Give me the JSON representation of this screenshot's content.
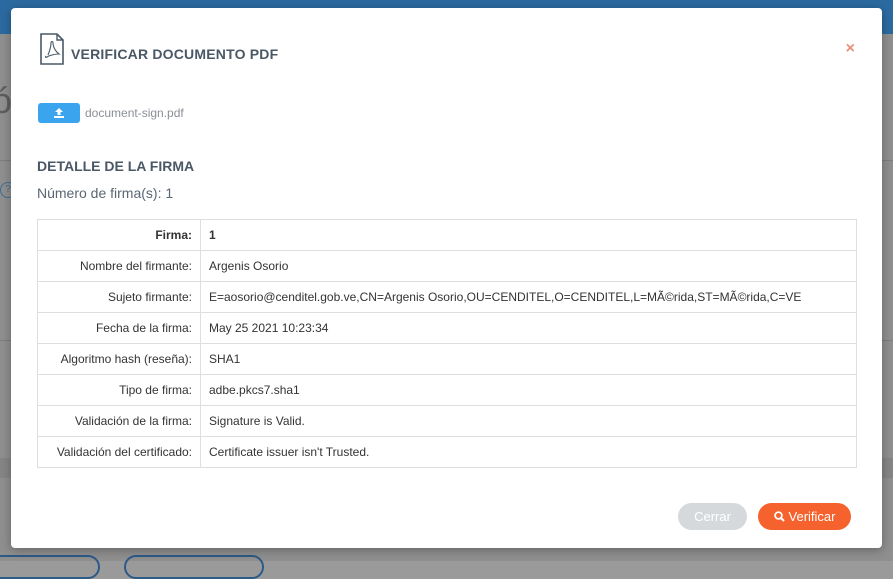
{
  "background": {
    "partial_glyph": "ó"
  },
  "modal": {
    "title": "VERIFICAR DOCUMENTO PDF",
    "title_icon": "pdf-file-icon",
    "close_label": "×",
    "upload_icon": "upload-icon",
    "file_name": "document-sign.pdf",
    "section_title": "DETALLE DE LA FIRMA",
    "signature_count": "Número de firma(s): 1",
    "rows": [
      {
        "label": "Firma:",
        "value": "1"
      },
      {
        "label": "Nombre del firmante:",
        "value": "Argenis Osorio"
      },
      {
        "label": "Sujeto firmante:",
        "value": "E=aosorio@cenditel.gob.ve,CN=Argenis Osorio,OU=CENDITEL,O=CENDITEL,L=MÃ©rida,ST=MÃ©rida,C=VE"
      },
      {
        "label": "Fecha de la firma:",
        "value": "May 25 2021 10:23:34"
      },
      {
        "label": "Algoritmo hash (reseña):",
        "value": "SHA1"
      },
      {
        "label": "Tipo de firma:",
        "value": "adbe.pkcs7.sha1"
      },
      {
        "label": "Validación de la firma:",
        "value": "Signature is Valid."
      },
      {
        "label": "Validación del certificado:",
        "value": "Certificate issuer isn't Trusted."
      }
    ],
    "cancel_label": "Cerrar",
    "verify_label": "Verificar",
    "verify_icon": "search-icon",
    "colors": {
      "accent": "#f5622d",
      "upload": "#3aa4ee",
      "cancel": "#d6d9dc",
      "close": "#e8907a"
    }
  }
}
